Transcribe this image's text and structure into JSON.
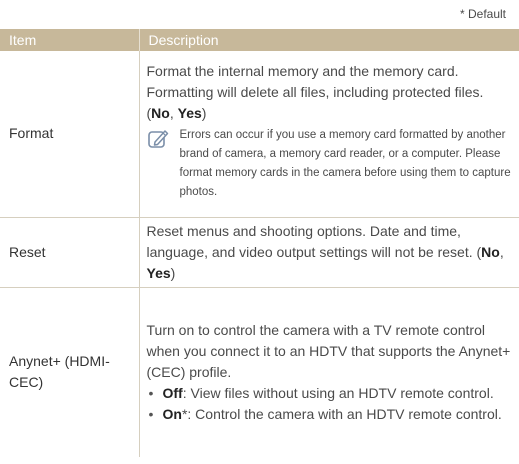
{
  "default_note": "* Default",
  "table": {
    "headers": {
      "item": "Item",
      "description": "Description"
    },
    "format": {
      "item": "Format",
      "desc": "Format the internal memory and the memory card. Formatting will delete all files, including protected files. (",
      "opt1": "No",
      "sep": ", ",
      "opt2": "Yes",
      "close": ")",
      "note": "Errors can occur if you use a memory card formatted by another brand of camera, a memory card reader, or a computer. Please format memory cards in the camera before using them to capture photos."
    },
    "reset": {
      "item": "Reset",
      "desc": "Reset menus and shooting options. Date and time, language, and video output settings will not be reset. (",
      "opt1": "No",
      "sep": ", ",
      "opt2": "Yes",
      "close": ")"
    },
    "anynet": {
      "item": "Anynet+ (HDMI-CEC)",
      "desc": "Turn on to control the camera with a TV remote control when you connect it to an HDTV that supports the Anynet+(CEC) profile.",
      "options": [
        {
          "label": "Off",
          "text": ": View files without using an HDTV remote control."
        },
        {
          "label": "On",
          "mark": "*",
          "text": ": Control the camera with an HDTV remote control."
        }
      ]
    }
  },
  "icons": {
    "note": "pencil-note-icon"
  },
  "colors": {
    "header_bg": "#c7b89a",
    "note_icon": "#7a8ea8"
  }
}
